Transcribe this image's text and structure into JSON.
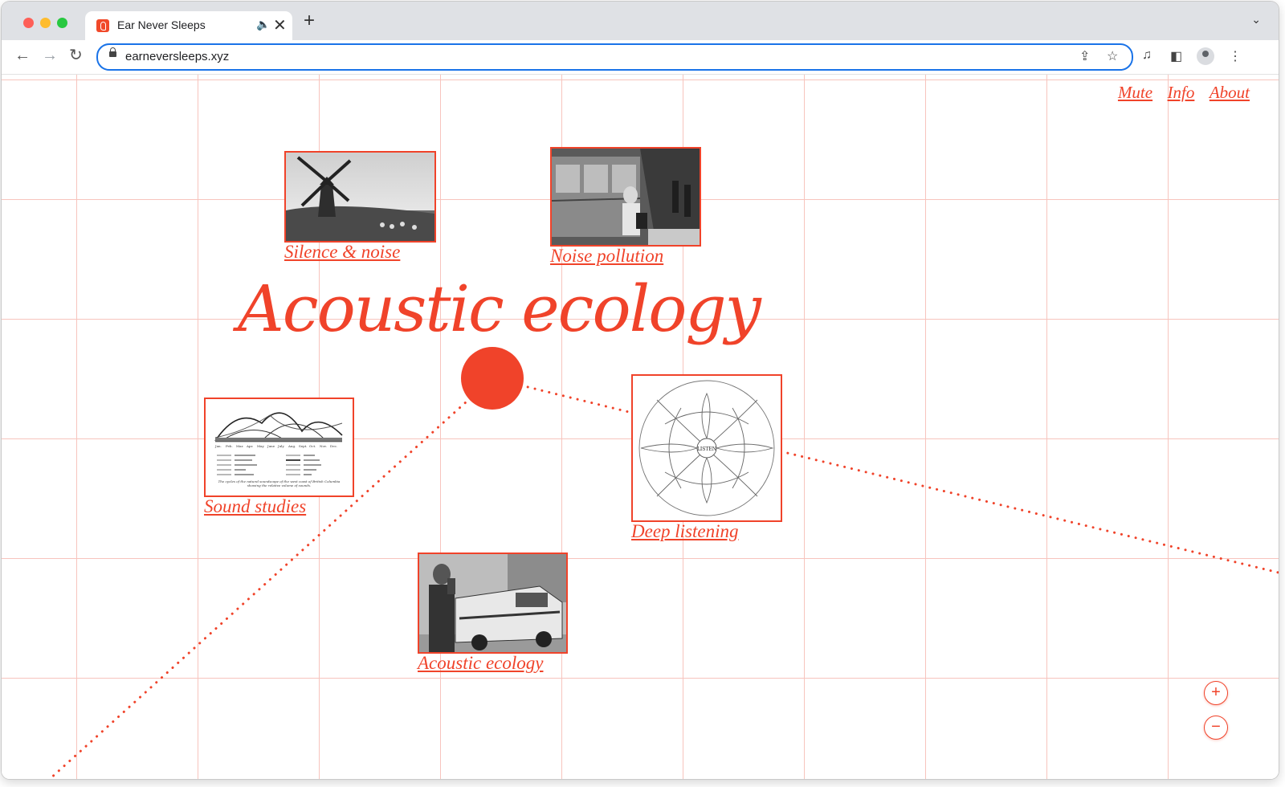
{
  "browser": {
    "tab_title": "Ear Never Sleeps",
    "url": "earneversleeps.xyz",
    "new_tab_glyph": "+",
    "close_glyph": "✕",
    "audio_glyph": "🔈",
    "back_glyph": "←",
    "forward_glyph": "→",
    "reload_glyph": "↻",
    "tab_menu_glyph": "⌄",
    "share_glyph": "⇪",
    "bookmark_glyph": "☆",
    "media_glyph": "♫",
    "sidebar_glyph": "◧",
    "more_glyph": "⋮"
  },
  "site_nav": {
    "mute": "Mute",
    "info": "Info",
    "about": "About"
  },
  "main": {
    "title": "Acoustic ecology"
  },
  "cards": [
    {
      "label": "Silence & noise",
      "image": "windmill-photo"
    },
    {
      "label": "Noise pollution",
      "image": "subway-photo"
    },
    {
      "label": "Sound studies",
      "image": "soundscape-chart"
    },
    {
      "label": "Deep listening",
      "image": "listen-diagram"
    },
    {
      "label": "Acoustic ecology",
      "image": "van-photo"
    }
  ],
  "diagram_text": {
    "center": "LISTEN"
  },
  "chart_text": {
    "months": [
      "Jan.",
      "Feb.",
      "Mar.",
      "Apr.",
      "May",
      "June",
      "July",
      "Aug.",
      "Sept.",
      "Oct.",
      "Nov.",
      "Dec."
    ],
    "caption": "The cycles of the natural soundscape of the west coast of British Columbia showing the relative volume of sounds."
  },
  "zoom": {
    "in_glyph": "+",
    "out_glyph": "−"
  },
  "colors": {
    "accent": "#f0432a",
    "grid": "#f7c4bd"
  }
}
